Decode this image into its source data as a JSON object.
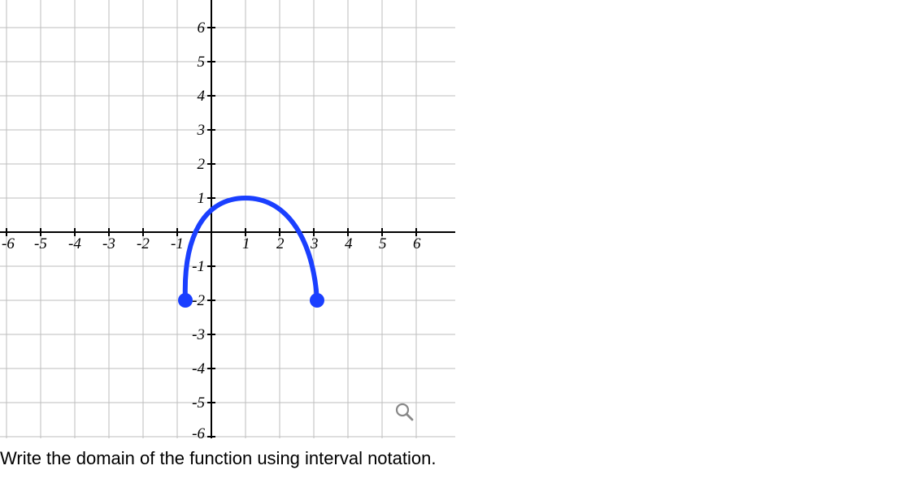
{
  "chart_data": {
    "type": "line",
    "title": "",
    "xlabel": "",
    "ylabel": "",
    "xlim": [
      -6.5,
      6.5
    ],
    "ylim": [
      -6.5,
      6.5
    ],
    "x_ticks": [
      -6,
      -5,
      -4,
      -3,
      -2,
      -1,
      1,
      2,
      3,
      4,
      5,
      6
    ],
    "y_ticks": [
      -6,
      -5,
      -4,
      -3,
      -2,
      -1,
      1,
      2,
      3,
      4,
      5,
      6
    ],
    "series": [
      {
        "name": "curve",
        "x": [
          -0.75,
          -0.5,
          0,
          0.5,
          1,
          1.5,
          2,
          2.5,
          3,
          3.1
        ],
        "y": [
          -2,
          -1,
          0.55,
          0.95,
          1,
          0.85,
          0.5,
          -0.25,
          -1.5,
          -2
        ],
        "endpoints": {
          "left_closed": true,
          "right_closed": true
        }
      }
    ]
  },
  "labels": {
    "x_neg6": "-6",
    "x_neg5": "-5",
    "x_neg4": "-4",
    "x_neg3": "-3",
    "x_neg2": "-2",
    "x_neg1": "-1",
    "x_1": "1",
    "x_2": "2",
    "x_3": "3",
    "x_4": "4",
    "x_5": "5",
    "x_6": "6",
    "y_neg6": "-6",
    "y_neg5": "-5",
    "y_neg4": "-4",
    "y_neg3": "-3",
    "y_neg2": "-2",
    "y_neg1": "-1",
    "y_1": "1",
    "y_2": "2",
    "y_3": "3",
    "y_4": "4",
    "y_5": "5",
    "y_6": "6"
  },
  "prompt_text": "Write the domain of the function using interval notation."
}
